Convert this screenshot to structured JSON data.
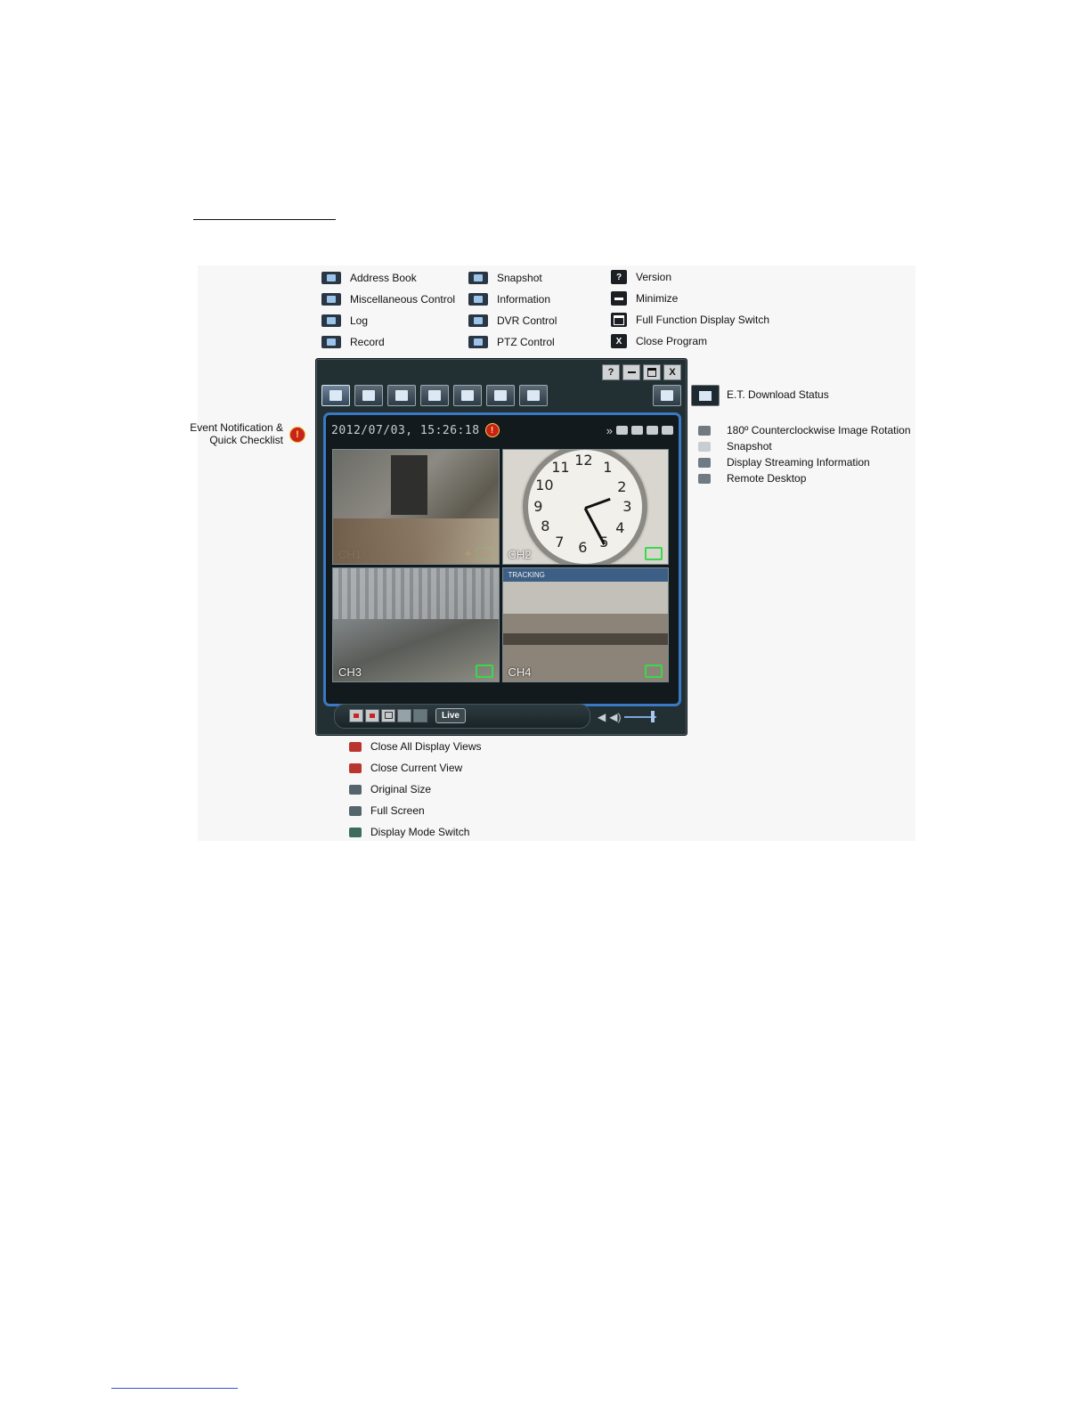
{
  "legend": {
    "col1": [
      {
        "label": "Address Book",
        "icon": "address-book-icon"
      },
      {
        "label": "Miscellaneous Control",
        "icon": "misc-control-icon"
      },
      {
        "label": "Log",
        "icon": "log-icon"
      },
      {
        "label": "Record",
        "icon": "record-icon"
      }
    ],
    "col2": [
      {
        "label": "Snapshot",
        "icon": "snapshot-icon"
      },
      {
        "label": "Information",
        "icon": "information-icon"
      },
      {
        "label": "DVR Control",
        "icon": "dvr-control-icon"
      },
      {
        "label": "PTZ Control",
        "icon": "ptz-control-icon"
      }
    ],
    "col3": [
      {
        "label": "Version",
        "icon": "version-icon",
        "glyph": "?"
      },
      {
        "label": "Minimize",
        "icon": "minimize-icon"
      },
      {
        "label": "Full Function Display Switch",
        "icon": "full-function-icon"
      },
      {
        "label": "Close Program",
        "icon": "close-icon",
        "glyph": "X"
      }
    ]
  },
  "app": {
    "title_buttons": {
      "help": "?",
      "close": "X"
    },
    "hud": {
      "datetime": "2012/07/03, 15:26:18",
      "alert_glyph": "!",
      "more_glyph": "»"
    },
    "channels": [
      "CH1",
      "CH2",
      "CH3",
      "CH4"
    ],
    "cam4_tag": "TRACKING",
    "clock_numbers": [
      "12",
      "1",
      "2",
      "3",
      "4",
      "5",
      "6",
      "7",
      "8",
      "9",
      "10",
      "11"
    ],
    "live_label": "Live"
  },
  "callouts": {
    "event_notification": "Event Notification & Quick Checklist",
    "event_line1": "Event Notification &",
    "event_line2": "Quick Checklist",
    "download_status": "E.T. Download Status",
    "hud_right": [
      {
        "label": "180º Counterclockwise Image Rotation",
        "icon": "rotation-icon"
      },
      {
        "label": "Snapshot",
        "icon": "snapshot-small-icon"
      },
      {
        "label": "Display Streaming Information",
        "icon": "streaming-info-icon"
      },
      {
        "label": "Remote Desktop",
        "icon": "remote-desktop-icon"
      }
    ],
    "bottom": [
      {
        "label": "Close All Display Views",
        "icon": "close-all-views-icon"
      },
      {
        "label": "Close Current View",
        "icon": "close-current-view-icon"
      },
      {
        "label": "Original Size",
        "icon": "original-size-icon"
      },
      {
        "label": "Full Screen",
        "icon": "full-screen-icon"
      },
      {
        "label": "Display Mode Switch",
        "icon": "display-mode-icon"
      }
    ]
  },
  "colors": {
    "frame_blue": "#3a79c4",
    "alert_red": "#c8221d",
    "rec_green": "#38d94a",
    "app_bg": "#223034"
  }
}
